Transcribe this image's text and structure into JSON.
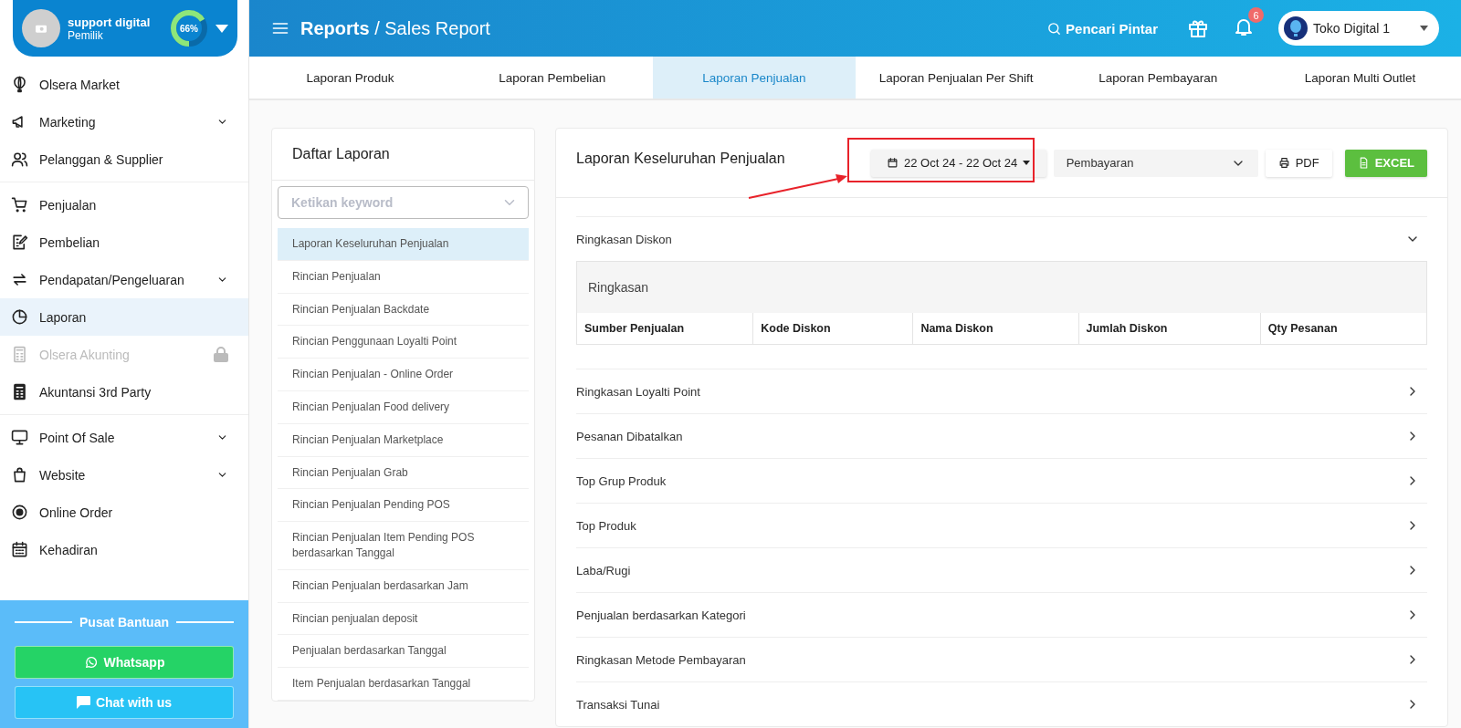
{
  "profile": {
    "name": "support digital",
    "role": "Pemilik",
    "progress_text": "66%",
    "level": 0.66
  },
  "sidebar": {
    "groups": [
      [
        {
          "label": "Olsera Market",
          "expandable": false,
          "selected": false,
          "disabled": false
        },
        {
          "label": "Marketing",
          "expandable": true,
          "selected": false,
          "disabled": false
        },
        {
          "label": "Pelanggan & Supplier",
          "expandable": false,
          "selected": false,
          "disabled": false
        }
      ],
      [
        {
          "label": "Penjualan",
          "expandable": false,
          "selected": false,
          "disabled": false
        },
        {
          "label": "Pembelian",
          "expandable": false,
          "selected": false,
          "disabled": false
        },
        {
          "label": "Pendapatan/Pengeluaran",
          "expandable": true,
          "selected": false,
          "disabled": false
        },
        {
          "label": "Laporan",
          "expandable": false,
          "selected": true,
          "disabled": false
        },
        {
          "label": "Olsera Akunting",
          "expandable": false,
          "selected": false,
          "disabled": true
        },
        {
          "label": "Akuntansi 3rd Party",
          "expandable": false,
          "selected": false,
          "disabled": false
        }
      ],
      [
        {
          "label": "Point Of Sale",
          "expandable": true,
          "selected": false,
          "disabled": false
        },
        {
          "label": "Website",
          "expandable": true,
          "selected": false,
          "disabled": false
        },
        {
          "label": "Online Order",
          "expandable": false,
          "selected": false,
          "disabled": false
        },
        {
          "label": "Kehadiran",
          "expandable": false,
          "selected": false,
          "disabled": false
        }
      ]
    ]
  },
  "help": {
    "title": "Pusat Bantuan",
    "buttons": [
      {
        "label": "Whatsapp",
        "kind": "whatsapp"
      },
      {
        "label": "Chat with us",
        "kind": "chat"
      }
    ]
  },
  "header": {
    "section": "Reports",
    "page": "/ Sales Report",
    "search_label": "Pencari Pintar",
    "notification_count": "6",
    "store": "Toko Digital 1"
  },
  "tabs": [
    {
      "label": "Laporan Produk",
      "selected": false
    },
    {
      "label": "Laporan Pembelian",
      "selected": false
    },
    {
      "label": "Laporan Penjualan",
      "selected": true
    },
    {
      "label": "Laporan Penjualan Per Shift",
      "selected": false
    },
    {
      "label": "Laporan Pembayaran",
      "selected": false
    },
    {
      "label": "Laporan Multi Outlet",
      "selected": false
    }
  ],
  "report_list": {
    "title": "Daftar Laporan",
    "placeholder": "Ketikan keyword",
    "items": [
      {
        "label": "Laporan Keseluruhan Penjualan",
        "selected": true
      },
      {
        "label": "Rincian Penjualan",
        "selected": false
      },
      {
        "label": "Rincian Penjualan Backdate",
        "selected": false
      },
      {
        "label": "Rincian Penggunaan Loyalti Point",
        "selected": false
      },
      {
        "label": "Rincian Penjualan - Online Order",
        "selected": false
      },
      {
        "label": "Rincian Penjualan Food delivery",
        "selected": false
      },
      {
        "label": "Rincian Penjualan Marketplace",
        "selected": false
      },
      {
        "label": "Rincian Penjualan Grab",
        "selected": false
      },
      {
        "label": "Rincian Penjualan Pending POS",
        "selected": false
      },
      {
        "label": "Rincian Penjualan Item Pending POS berdasarkan Tanggal",
        "selected": false
      },
      {
        "label": "Rincian Penjualan berdasarkan Jam",
        "selected": false
      },
      {
        "label": "Rincian penjualan deposit",
        "selected": false
      },
      {
        "label": "Penjualan berdasarkan Tanggal",
        "selected": false
      },
      {
        "label": "Item Penjualan berdasarkan Tanggal",
        "selected": false
      }
    ]
  },
  "report": {
    "title": "Laporan Keseluruhan Penjualan",
    "date_range": "22 Oct 24 - 22 Oct 24",
    "filter": "Pembayaran",
    "pdf_label": "PDF",
    "excel_label": "EXCEL",
    "sections": [
      {
        "title": "Ringkasan Diskon",
        "expanded": true,
        "table_title": "Ringkasan",
        "columns": [
          "Sumber Penjualan",
          "Kode Diskon",
          "Nama Diskon",
          "Jumlah Diskon",
          "Qty Pesanan"
        ]
      },
      {
        "title": "Ringkasan Loyalti Point",
        "expanded": false
      },
      {
        "title": "Pesanan Dibatalkan",
        "expanded": false
      },
      {
        "title": "Top Grup Produk",
        "expanded": false
      },
      {
        "title": "Top Produk",
        "expanded": false
      },
      {
        "title": "Laba/Rugi",
        "expanded": false
      },
      {
        "title": "Penjualan berdasarkan Kategori",
        "expanded": false
      },
      {
        "title": "Ringkasan Metode Pembayaran",
        "expanded": false
      },
      {
        "title": "Transaksi Tunai",
        "expanded": false
      }
    ]
  }
}
